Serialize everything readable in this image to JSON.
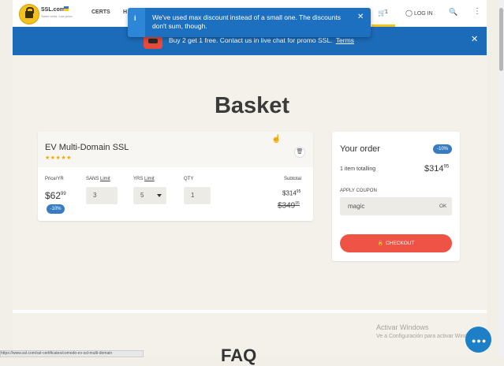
{
  "header": {
    "brand": "SSL.com",
    "brand_tagline": "Same certs. Low price.",
    "nav": {
      "certs": "CERTS",
      "h": "H"
    },
    "cart_count": "1",
    "login": "LOG IN"
  },
  "toast": {
    "message": "We've used max discount instead of a small one. The discounts don't sum, though."
  },
  "promo": {
    "text": "Buy 2 get 1 free. Contact us in live chat for promo SSL.",
    "link": "Terms"
  },
  "page_title": "Basket",
  "product": {
    "name": "EV Multi-Domain SSL",
    "rating_stars": 5,
    "price_label": "Price/YR",
    "price_main": "$62",
    "price_cents": "99",
    "discount_badge": "-10%",
    "sans_label": "SANS",
    "sans_link": "Limit",
    "sans_value": "3",
    "yrs_label": "YRS",
    "yrs_link": "Limit",
    "yrs_value": "5",
    "qty_label": "QTY",
    "qty_value": "1",
    "subtotal_label": "Subtotal",
    "subtotal_main": "$314",
    "subtotal_cents": "95",
    "old_main": "$349",
    "old_cents": "95"
  },
  "order": {
    "title": "Your order",
    "discount_badge": "-10%",
    "items_text": "1 item totalling",
    "total_main": "$314",
    "total_cents": "95",
    "coupon_label": "APPLY COUPON",
    "coupon_value": "magic",
    "coupon_ok": "OK",
    "checkout": "CHECKOUT"
  },
  "footer": {
    "faq_partial": "FAQ",
    "activate_title": "Activar Windows",
    "activate_sub": "Ve a Configuración para activar Windows.",
    "status_url": "https://www.ssl.com/ssl-certificates/comodo-ev-ssl-multi-domain"
  },
  "colors": {
    "accent_blue": "#1b6bb8",
    "checkout_red": "#ef5346",
    "star_gold": "#f2a900"
  }
}
